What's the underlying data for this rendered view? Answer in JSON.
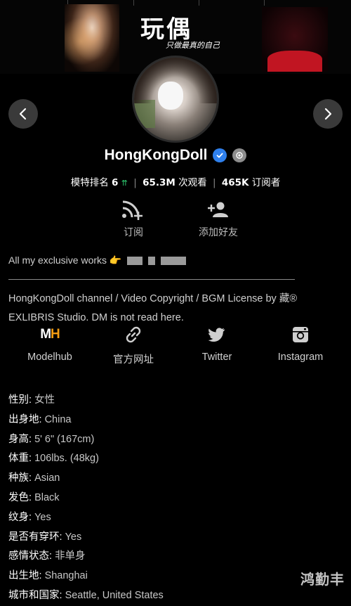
{
  "banner": {
    "title": "玩偶",
    "subtitle": "只做最真的自己"
  },
  "profile": {
    "name": "HongKongDoll",
    "rank_label": "模特排名",
    "rank_value": "6",
    "views_value": "65.3M",
    "views_label": "次观看",
    "subs_value": "465K",
    "subs_label": "订阅者"
  },
  "actions": {
    "subscribe_label": "订阅",
    "add_friend_label": "添加好友"
  },
  "about": {
    "text": "All my exclusive works 👉",
    "description": "HongKongDoll channel / Video Copyright / BGM License by 藏® EXLIBRIS Studio. DM is not read here."
  },
  "social": [
    {
      "label": "Modelhub",
      "icon": "modelhub-icon"
    },
    {
      "label": "官方网址",
      "icon": "link-icon"
    },
    {
      "label": "Twitter",
      "icon": "twitter-icon"
    },
    {
      "label": "Instagram",
      "icon": "instagram-icon"
    }
  ],
  "social_logo": {
    "m": "M",
    "h": "H"
  },
  "details": [
    {
      "key": "性别:",
      "value": "女性"
    },
    {
      "key": "出身地:",
      "value": "China"
    },
    {
      "key": "身高:",
      "value": "5' 6\" (167cm)"
    },
    {
      "key": "体重:",
      "value": "106lbs. (48kg)"
    },
    {
      "key": "种族:",
      "value": "Asian"
    },
    {
      "key": "发色:",
      "value": "Black"
    },
    {
      "key": "纹身:",
      "value": "Yes"
    },
    {
      "key": "是否有穿环:",
      "value": "Yes"
    },
    {
      "key": "感情状态:",
      "value": "非单身"
    },
    {
      "key": "出生地:",
      "value": "Shanghai"
    },
    {
      "key": "城市和国家:",
      "value": "Seattle, United States"
    }
  ],
  "watermark": "鸿勤丰",
  "colors": {
    "background": "#000000",
    "verified": "#2f80ed",
    "rank_up": "#2ecc71",
    "modelhub_h": "#f39c12"
  }
}
